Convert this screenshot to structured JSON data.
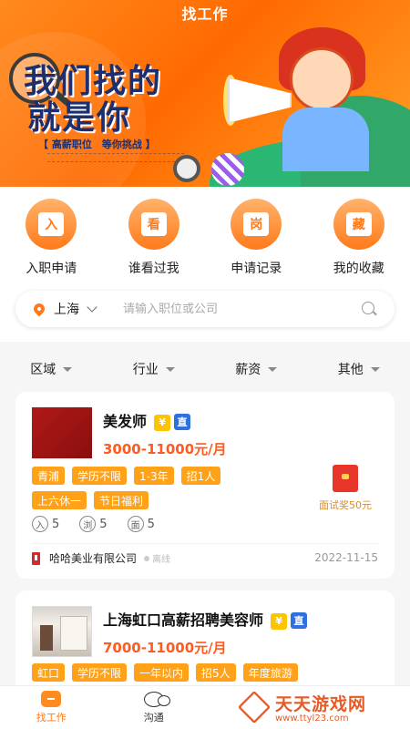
{
  "header": {
    "title": "找工作"
  },
  "banner": {
    "slogan_line1": "我们找的",
    "slogan_line2": "就是你",
    "tagline": "【 高薪职位　等你挑战 】"
  },
  "quick_actions": [
    {
      "icon_char": "入",
      "label": "入职申请",
      "icon": "entry-doc-icon"
    },
    {
      "icon_char": "看",
      "label": "谁看过我",
      "icon": "viewed-doc-icon"
    },
    {
      "icon_char": "岗",
      "label": "申请记录",
      "icon": "record-doc-icon"
    },
    {
      "icon_char": "藏",
      "label": "我的收藏",
      "icon": "favorite-doc-icon"
    }
  ],
  "search": {
    "city": "上海",
    "placeholder": "请输入职位或公司"
  },
  "filters": [
    {
      "label": "区域"
    },
    {
      "label": "行业"
    },
    {
      "label": "薪资"
    },
    {
      "label": "其他"
    }
  ],
  "jobs": [
    {
      "title": "美发师",
      "badge_y": "¥",
      "badge_z": "直",
      "salary": "3000-11000元/月",
      "tags_row1": [
        "青浦",
        "学历不限",
        "1-3年",
        "招1人"
      ],
      "tags_row2": [
        "上六休一",
        "节日福利"
      ],
      "stats": [
        {
          "icon_char": "入",
          "value": "5"
        },
        {
          "icon_char": "浏",
          "value": "5"
        },
        {
          "icon_char": "面",
          "value": "5"
        }
      ],
      "company": "哈哈美业有限公司",
      "status": "离线",
      "date": "2022-11-15",
      "reward": "面试奖50元"
    },
    {
      "title": "上海虹口高薪招聘美容师",
      "badge_y": "¥",
      "badge_z": "直",
      "salary": "7000-11000元/月",
      "tags_row1": [
        "虹口",
        "学历不限",
        "一年以内",
        "招5人",
        "年度旅游"
      ]
    }
  ],
  "bottom_nav": [
    {
      "label": "找工作",
      "active": true
    },
    {
      "label": "沟通",
      "active": false
    }
  ],
  "watermark": {
    "name": "天天游戏网",
    "url": "www.ttyl23.com"
  },
  "colors": {
    "accent": "#ff7a1a",
    "salary": "#ff5a1f",
    "tag": "#ffa21a",
    "badge_blue": "#2f6fe0",
    "badge_yellow": "#ffc400"
  }
}
